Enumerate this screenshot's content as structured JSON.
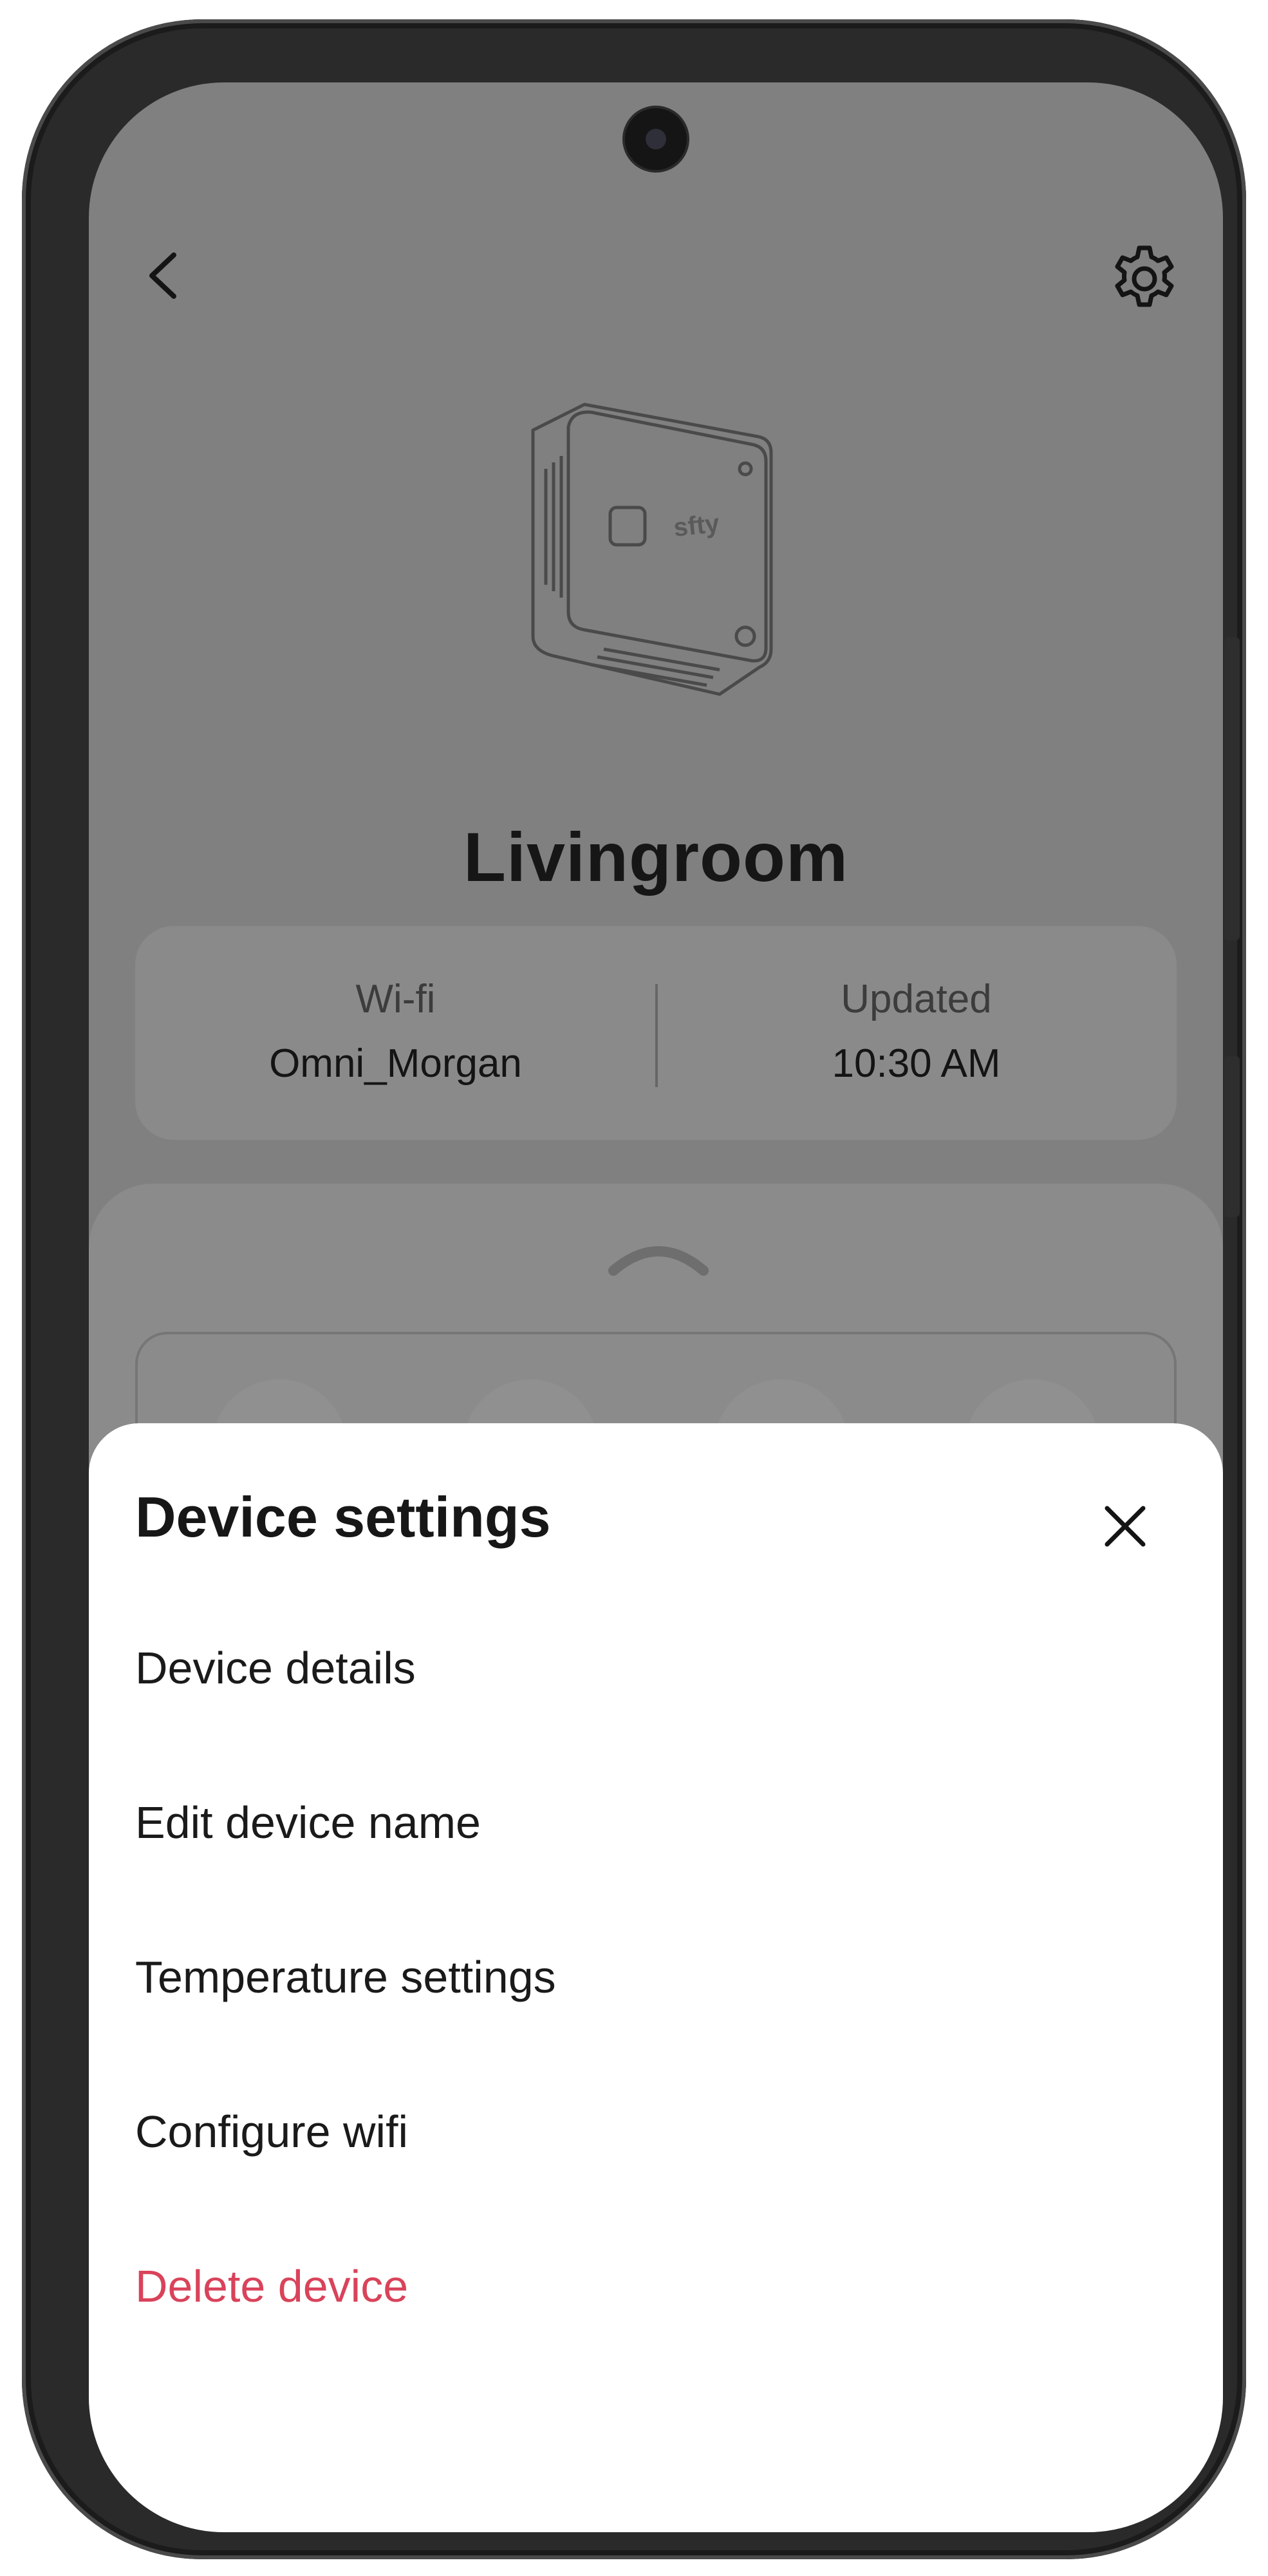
{
  "header": {
    "back_icon": "chevron-left-icon",
    "settings_icon": "gear-icon"
  },
  "device": {
    "name": "Livingroom",
    "logo_text": "sfty"
  },
  "info_card": {
    "wifi_label": "Wi-fi",
    "wifi_value": "Omni_Morgan",
    "updated_label": "Updated",
    "updated_value": "10:30 AM"
  },
  "sheet": {
    "title": "Device settings",
    "close_icon": "close-icon",
    "items": [
      {
        "label": "Device details"
      },
      {
        "label": "Edit device name"
      },
      {
        "label": "Temperature settings"
      },
      {
        "label": "Configure wifi"
      },
      {
        "label": "Delete device"
      }
    ]
  },
  "colors": {
    "scrim": "#808080",
    "danger": "#d9435a",
    "text": "#1a1a1a"
  }
}
